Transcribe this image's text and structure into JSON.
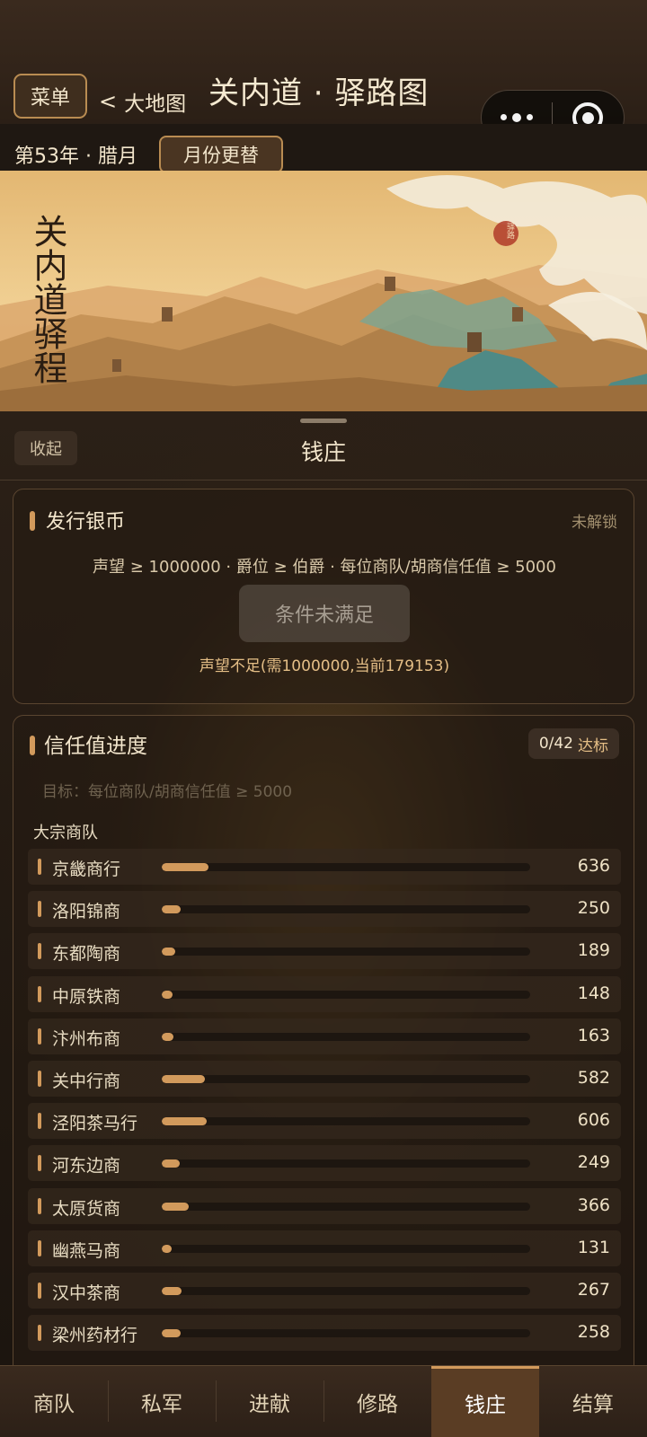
{
  "header": {
    "menu_label": "菜单",
    "back_label": "大地图",
    "title": "关内道 · 驿路图"
  },
  "subheader": {
    "date": "第53年 · 腊月",
    "month_button": "月份更替"
  },
  "banner": {
    "vertical_title": "关内道驿程",
    "seal_text": "驿路"
  },
  "panel": {
    "collapse_label": "收起",
    "title": "钱庄"
  },
  "issue_coin": {
    "title": "发行银币",
    "status": "未解锁",
    "conditions": "声望 ≥ 1000000 · 爵位 ≥ 伯爵 · 每位商队/胡商信任值 ≥ 5000",
    "button_label": "条件未满足",
    "warning": "声望不足(需1000000,当前179153)"
  },
  "trust": {
    "title": "信任值进度",
    "badge_count": "0/42",
    "badge_label": "达标",
    "goal": "目标：每位商队/胡商信任值 ≥ 5000",
    "group_label": "大宗商队",
    "target_value": 5000,
    "merchants": [
      {
        "name": "京畿商行",
        "value": 636
      },
      {
        "name": "洛阳锦商",
        "value": 250
      },
      {
        "name": "东都陶商",
        "value": 189
      },
      {
        "name": "中原铁商",
        "value": 148
      },
      {
        "name": "汴州布商",
        "value": 163
      },
      {
        "name": "关中行商",
        "value": 582
      },
      {
        "name": "泾阳茶马行",
        "value": 606
      },
      {
        "name": "河东边商",
        "value": 249
      },
      {
        "name": "太原货商",
        "value": 366
      },
      {
        "name": "幽燕马商",
        "value": 131
      },
      {
        "name": "汉中茶商",
        "value": 267
      },
      {
        "name": "梁州药材行",
        "value": 258
      }
    ]
  },
  "tabs": [
    {
      "label": "商队",
      "active": false
    },
    {
      "label": "私军",
      "active": false
    },
    {
      "label": "进献",
      "active": false
    },
    {
      "label": "修路",
      "active": false
    },
    {
      "label": "钱庄",
      "active": true
    },
    {
      "label": "结算",
      "active": false
    }
  ],
  "colors": {
    "accent": "#d29a5c",
    "gold_text": "#e4be86",
    "panel_bg": "#231a12"
  }
}
